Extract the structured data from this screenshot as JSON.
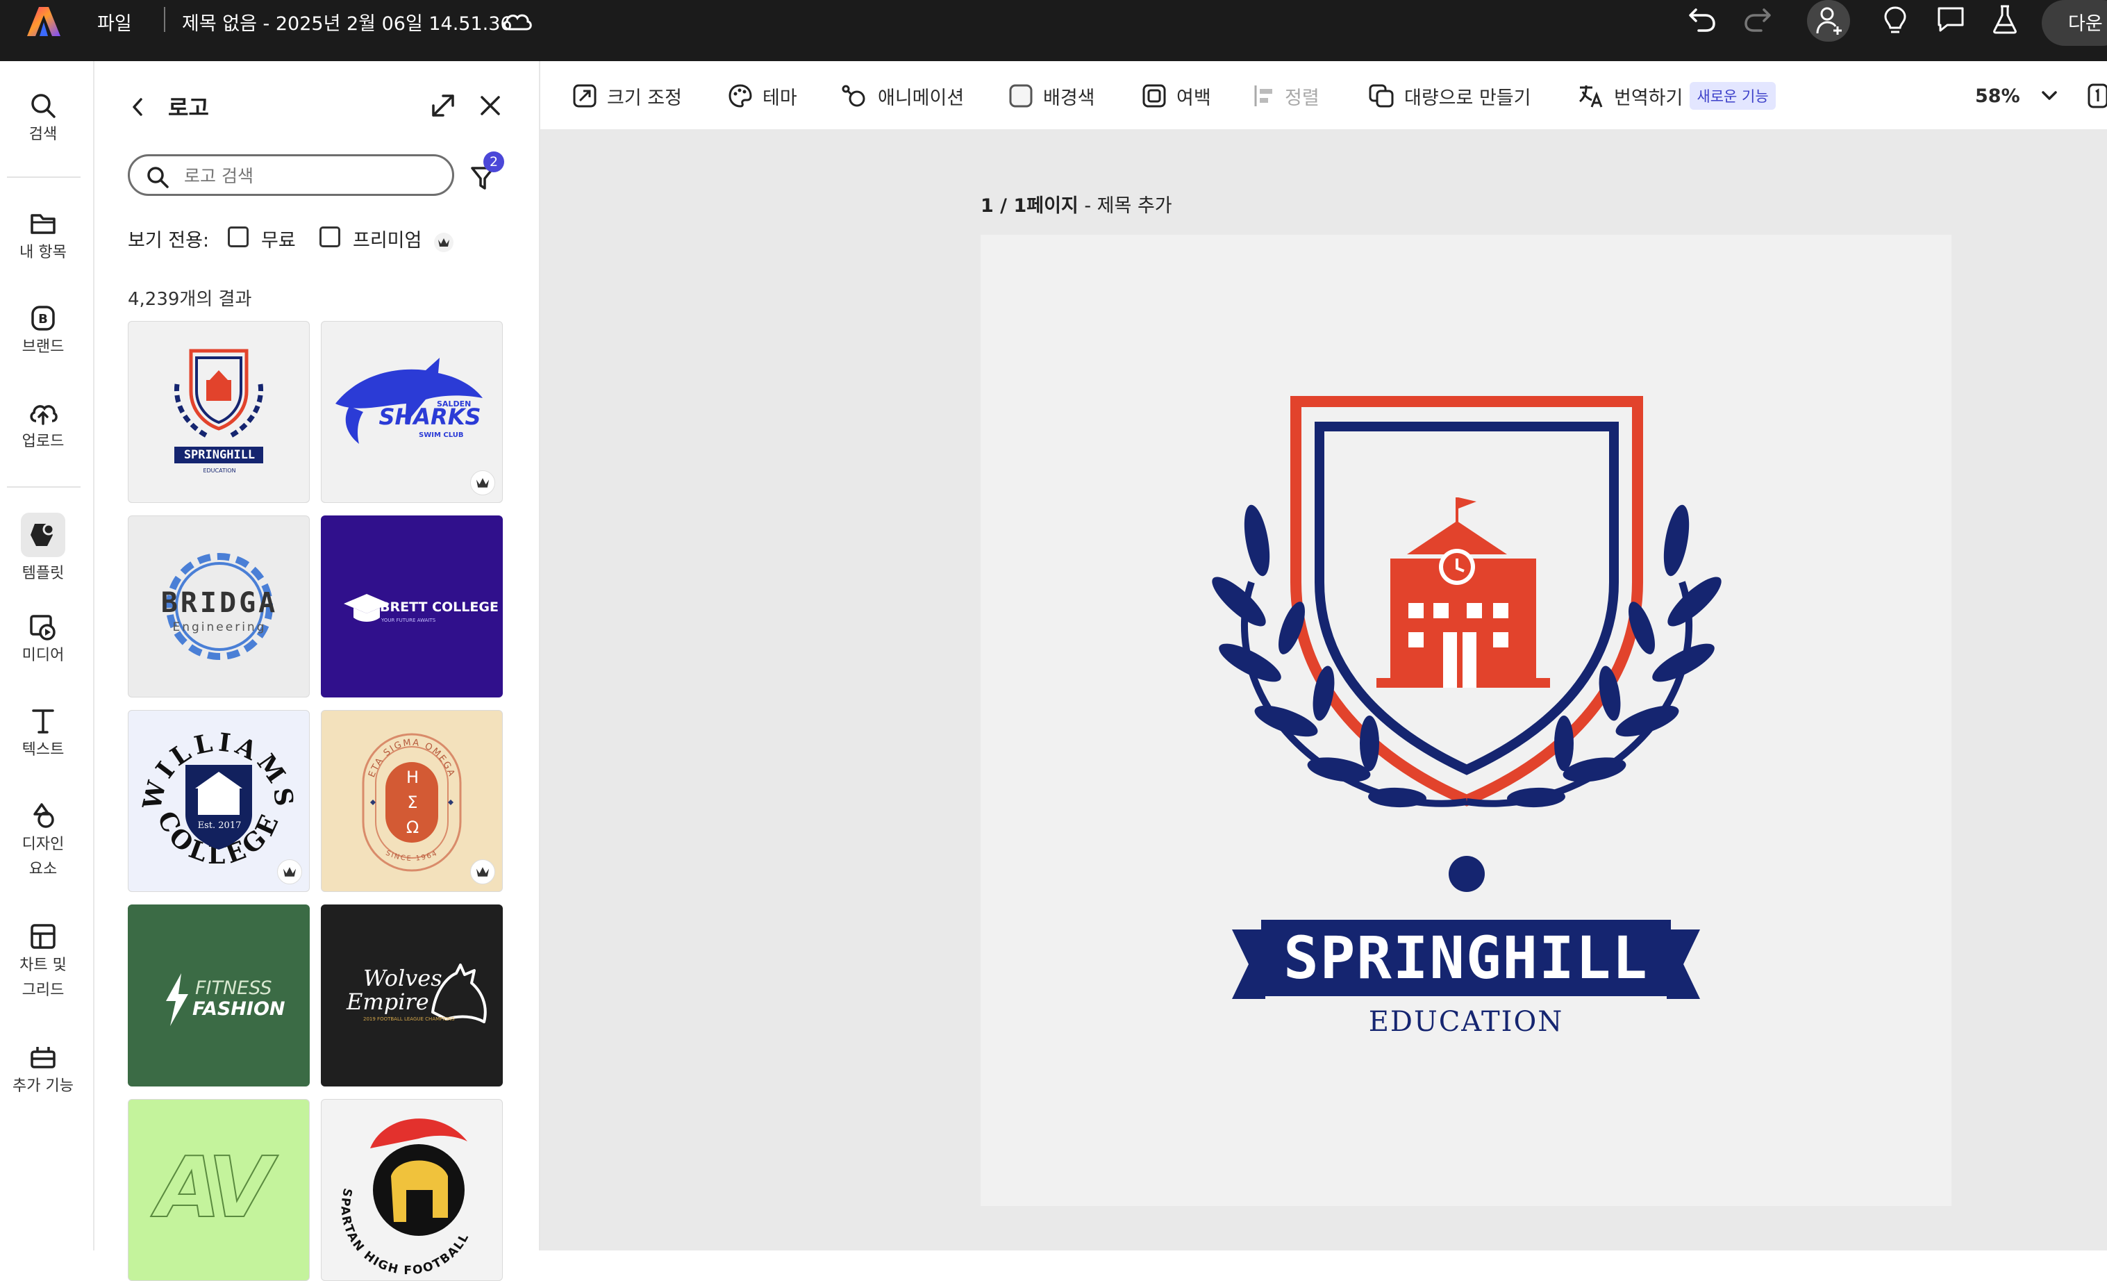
{
  "topbar": {
    "file_menu": "파일",
    "doc_title": "제목 없음 - 2025년 2월 06일 14.51.36",
    "next_label": "다운"
  },
  "rail": {
    "items": [
      {
        "label": "검색"
      },
      {
        "label": "내 항목"
      },
      {
        "label": "브랜드"
      },
      {
        "label": "업로드"
      },
      {
        "label": "템플릿"
      },
      {
        "label": "미디어"
      },
      {
        "label": "텍스트"
      },
      {
        "label": "디자인",
        "label2": "요소"
      },
      {
        "label": "차트 및",
        "label2": "그리드"
      },
      {
        "label": "추가 기능"
      }
    ]
  },
  "panel": {
    "title": "로고",
    "search_placeholder": "로고 검색",
    "filter_count": "2",
    "view_only_label": "보기 전용:",
    "free_label": "무료",
    "premium_label": "프리미엄",
    "results": "4,239개의 결과",
    "thumbs": {
      "springhill": "SPRINGHILL",
      "springhill_sub": "EDUCATION",
      "sharks": "SHARKS",
      "sharks_top": "SALDEN",
      "sharks_sub": "SWIM CLUB",
      "bridga": "BRIDGA",
      "bridga_sub": "Engineering",
      "brett": "BRETT COLLEGE",
      "brett_sub": "YOUR FUTURE AWAITS",
      "williams_top": "WILLIAMS",
      "williams_bottom": "COLLEGE",
      "williams_est": "Est. 2017",
      "eta_top": "ETA SIGMA OMEGA",
      "eta_bottom": "SINCE 1964",
      "eta_l1": "H",
      "eta_l2": "Σ",
      "eta_l3": "Ω",
      "fitness": "FITNESS",
      "fashion": "FASHION",
      "wolves": "Wolves",
      "empire": "Empire",
      "wolves_sub": "2019 FOOTBALL LEAGUE CHAMPIONS",
      "av": "AV",
      "spartan": "SPARTAN HIGH FOOTBALL"
    }
  },
  "toolbar": {
    "resize": "크기 조정",
    "theme": "테마",
    "animation": "애니메이션",
    "background": "배경색",
    "margin": "여백",
    "align": "정렬",
    "bulk": "대량으로 만들기",
    "translate": "번역하기",
    "new_badge": "새로운 기능",
    "zoom": "58%"
  },
  "canvas": {
    "page_num": "1 / 1페이지",
    "page_title": "- 제목 추가",
    "logo_name": "SPRINGHILL",
    "logo_sub": "EDUCATION"
  },
  "colors": {
    "navy": "#152570",
    "red": "#E2432C",
    "topbar": "#1b1b1b",
    "accent": "#5258E4"
  }
}
